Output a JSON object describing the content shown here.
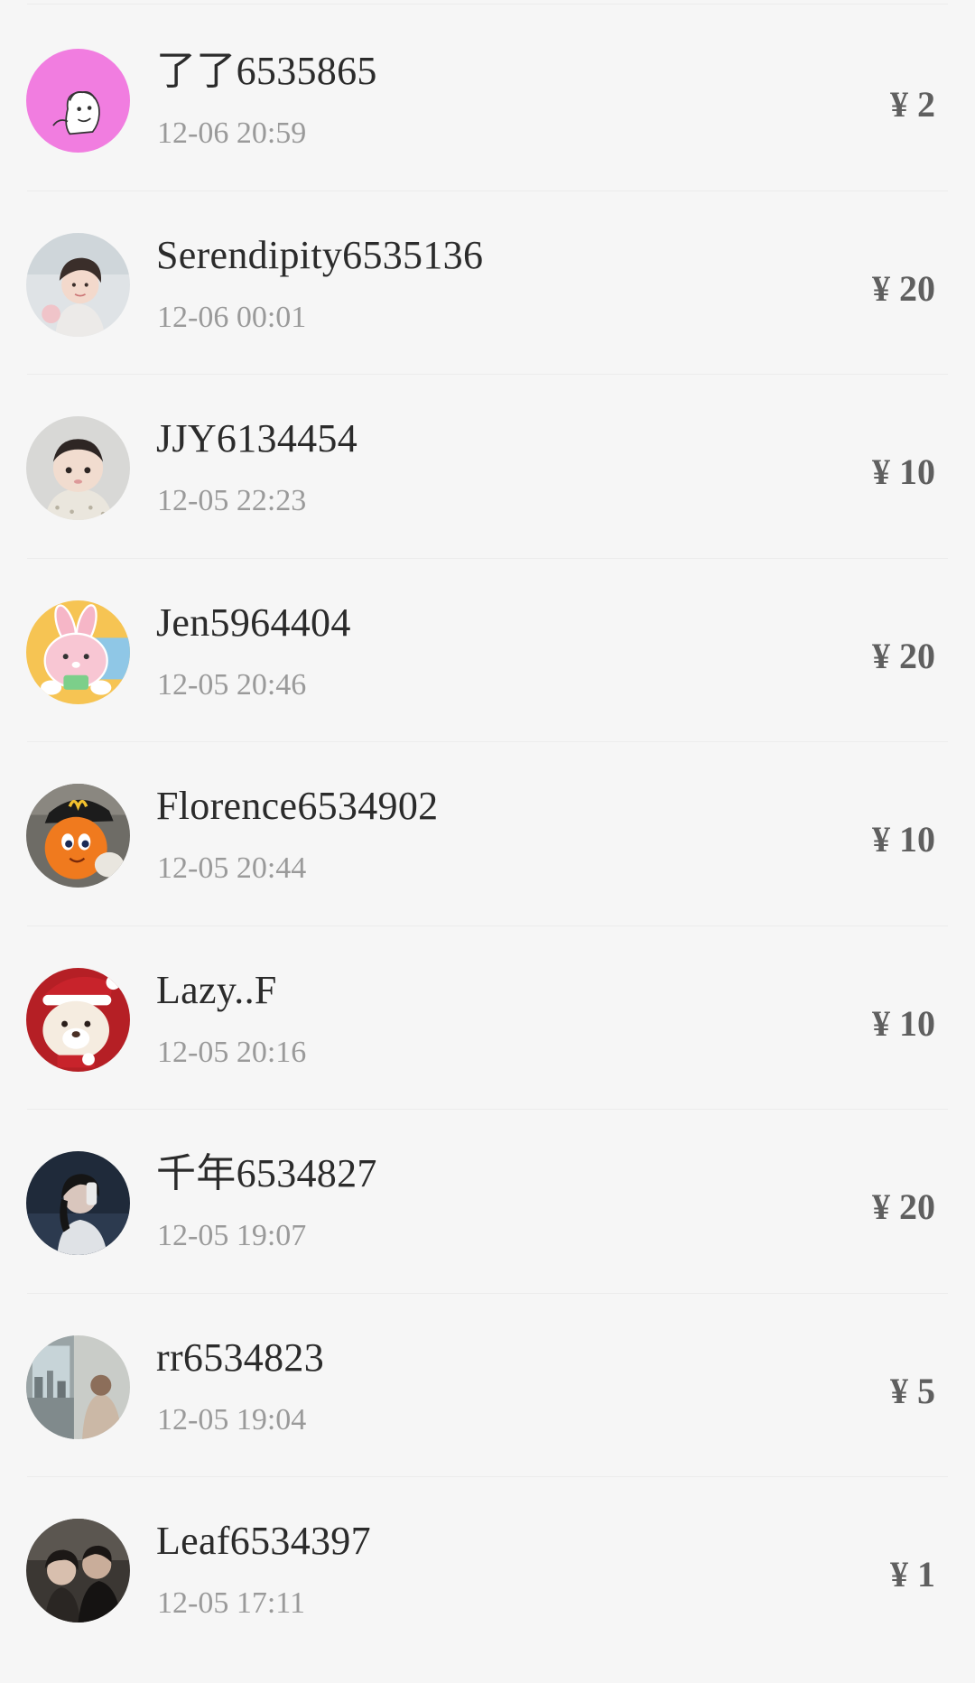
{
  "tips": [
    {
      "name": "了了6535865",
      "time": "12-06 20:59",
      "amount": "¥ 2",
      "avatar": "cartoon-face-pink-avatar"
    },
    {
      "name": "Serendipity6535136",
      "time": "12-06 00:01",
      "amount": "¥ 20",
      "avatar": "girl-photo-avatar"
    },
    {
      "name": "JJY6134454",
      "time": "12-05 22:23",
      "amount": "¥ 10",
      "avatar": "baby-photo-avatar"
    },
    {
      "name": "Jen5964404",
      "time": "12-05 20:46",
      "amount": "¥ 20",
      "avatar": "pink-bunny-cartoon-avatar"
    },
    {
      "name": "Florence6534902",
      "time": "12-05 20:44",
      "amount": "¥ 10",
      "avatar": "orange-mascot-avatar"
    },
    {
      "name": "Lazy..F",
      "time": "12-05 20:16",
      "amount": "¥ 10",
      "avatar": "christmas-bear-avatar"
    },
    {
      "name": "千年6534827",
      "time": "12-05 19:07",
      "amount": "¥ 20",
      "avatar": "dark-portrait-avatar"
    },
    {
      "name": "rr6534823",
      "time": "12-05 19:04",
      "amount": "¥ 5",
      "avatar": "window-scene-avatar"
    },
    {
      "name": "Leaf6534397",
      "time": "12-05 17:11",
      "amount": "¥ 1",
      "avatar": "couple-photo-avatar"
    }
  ],
  "colors": {
    "background": "#f6f6f6",
    "name": "#2b2b2b",
    "time": "#9a9a9a",
    "amount": "#5f5f5f",
    "avatar_pink": "#f17de0"
  }
}
